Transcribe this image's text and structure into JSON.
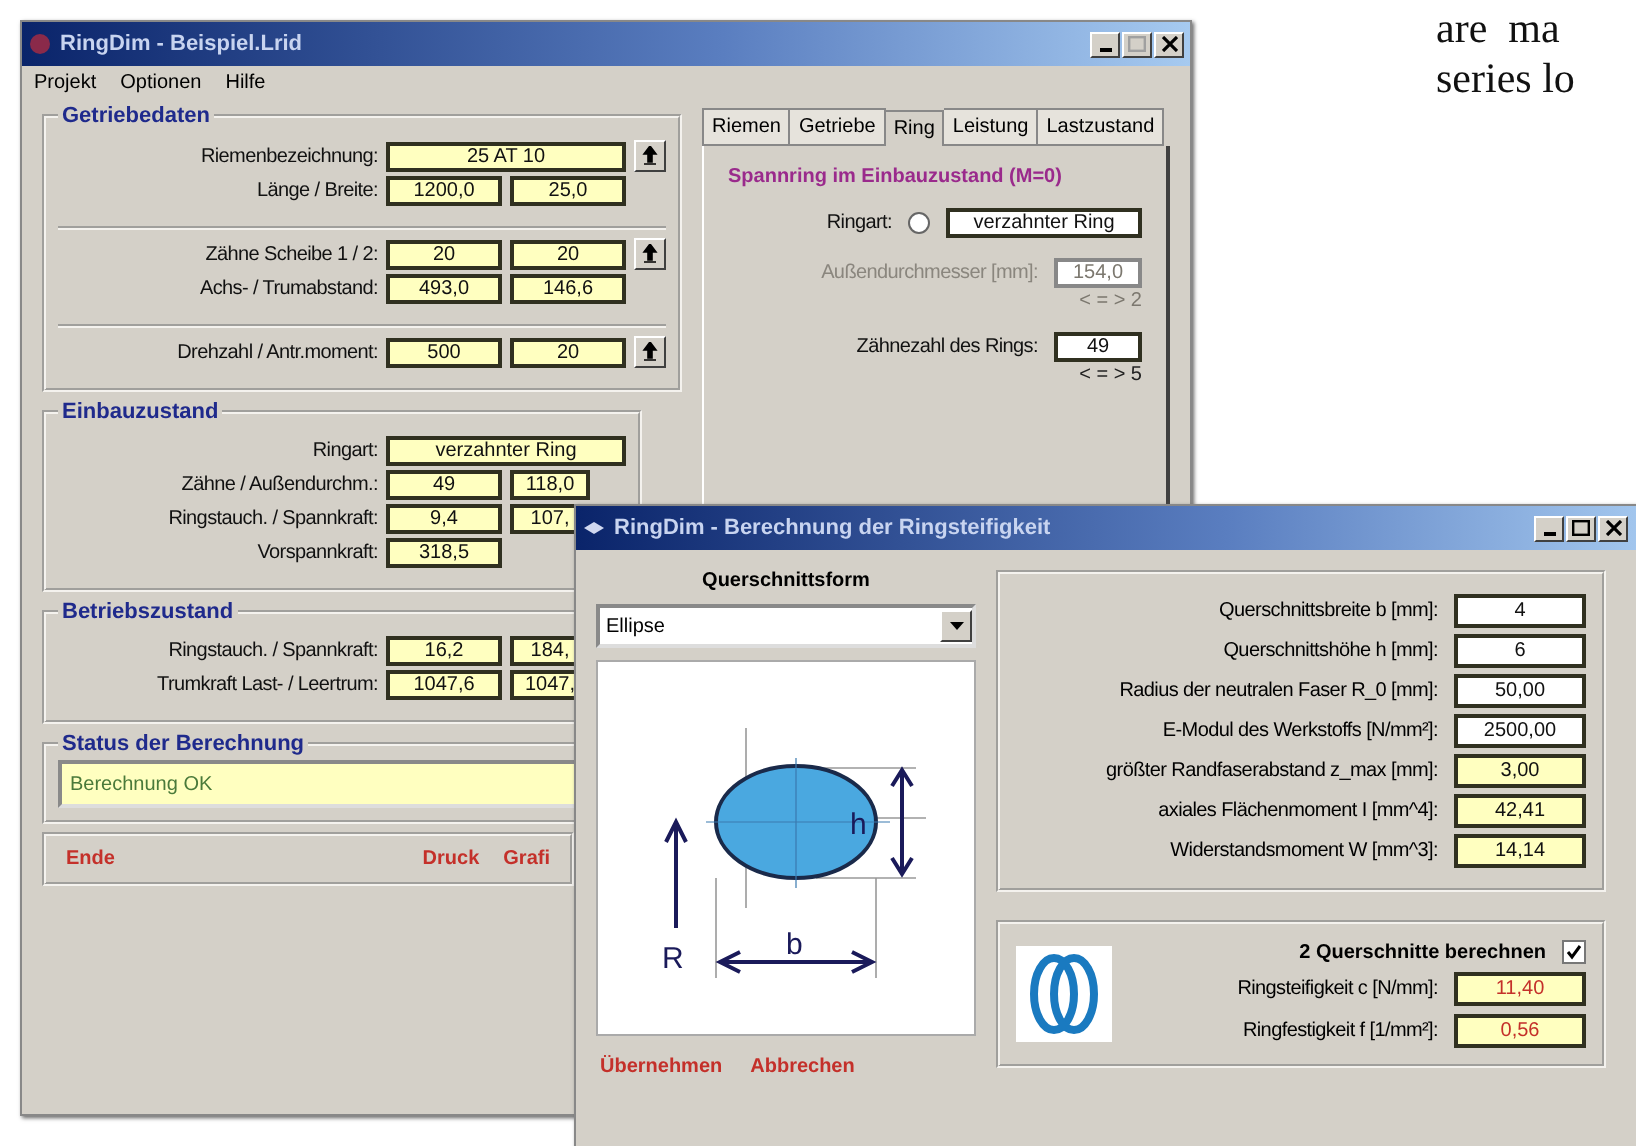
{
  "background_text": [
    "are  ma",
    "series lo"
  ],
  "main_window": {
    "title": "RingDim - Beispiel.Lrid",
    "controls": [
      {
        "kind": "minimize",
        "disabled": false
      },
      {
        "kind": "maximize",
        "disabled": true
      },
      {
        "kind": "close",
        "disabled": false
      }
    ],
    "menu": [
      "Projekt",
      "Optionen",
      "Hilfe"
    ],
    "groups": [
      {
        "title": "Getriebedaten",
        "sections": [
          {
            "rows": [
              {
                "label": "Riemenbezeichnung:",
                "values": [
                  "25 AT 10"
                ],
                "wide": true,
                "action": true
              },
              {
                "label": "Länge / Breite:",
                "values": [
                  "1200,0",
                  "25,0"
                ],
                "wide": false,
                "action": false
              }
            ]
          },
          {
            "rows": [
              {
                "label": "Zähne Scheibe 1 / 2:",
                "values": [
                  "20",
                  "20"
                ],
                "wide": false,
                "action": true
              },
              {
                "label": "Achs- / Trumabstand:",
                "values": [
                  "493,0",
                  "146,6"
                ],
                "wide": false,
                "action": false
              }
            ]
          },
          {
            "rows": [
              {
                "label": "Drehzahl / Antr.moment:",
                "values": [
                  "500",
                  "20"
                ],
                "wide": false,
                "action": true
              }
            ]
          }
        ]
      },
      {
        "title": "Einbauzustand",
        "sections": [
          {
            "rows": [
              {
                "label": "Ringart:",
                "values": [
                  "verzahnter Ring"
                ],
                "wide": true,
                "action": false
              },
              {
                "label": "Zähne / Außendurchm.:",
                "values": [
                  "49",
                  "118,0"
                ],
                "wide": false,
                "action": false
              },
              {
                "label": "Ringstauch. / Spannkraft:",
                "values": [
                  "9,4",
                  "107,"
                ],
                "wide": false,
                "action": false
              },
              {
                "label": "Vorspannkraft:",
                "values": [
                  "318,5"
                ],
                "wide": false,
                "action": false
              }
            ]
          }
        ]
      },
      {
        "title": "Betriebszustand",
        "sections": [
          {
            "rows": [
              {
                "label": "Ringstauch. / Spannkraft:",
                "values": [
                  "16,2",
                  "184,"
                ],
                "wide": false,
                "action": false
              },
              {
                "label": "Trumkraft Last- / Leertrum:",
                "values": [
                  "1047,6",
                  "1047,"
                ],
                "wide": false,
                "action": false
              }
            ]
          }
        ]
      }
    ],
    "status": {
      "title": "Status der Berechnung",
      "message": "Berechnung OK"
    },
    "buttons": [
      "Ende",
      "Druck",
      "Grafi"
    ]
  },
  "tab_panel": {
    "tabs": [
      {
        "label": "Riemen",
        "selected": false
      },
      {
        "label": "Getriebe",
        "selected": false
      },
      {
        "label": "Ring",
        "selected": true
      },
      {
        "label": "Leistung",
        "selected": false
      },
      {
        "label": "Lastzustand",
        "selected": false
      }
    ],
    "heading": "Spannring im Einbauzustand (M=0)",
    "ringart": {
      "label": "Ringart:",
      "selected": false,
      "value": "verzahnter Ring"
    },
    "rows": [
      {
        "label": "Außendurchmesser [mm]:",
        "value": "154,0",
        "stepper": "< = > 2",
        "disabled": true
      },
      {
        "label": "Zähnezahl des Rings:",
        "value": "49",
        "stepper": "< = > 5",
        "disabled": false
      }
    ]
  },
  "dialog": {
    "title": "RingDim - Berechnung der Ringsteifigkeit",
    "controls": [
      {
        "kind": "minimize",
        "disabled": false
      },
      {
        "kind": "maximize",
        "disabled": false
      },
      {
        "kind": "close",
        "disabled": false
      }
    ],
    "shape_label": "Querschnittsform",
    "shape": "Ellipse",
    "dimension_labels": [
      "h",
      "R",
      "b"
    ],
    "buttons": [
      "Übernehmen",
      "Abbrechen"
    ],
    "properties": [
      {
        "label": "Querschnittsbreite b [mm]:",
        "value": "4",
        "kind": "input"
      },
      {
        "label": "Querschnittshöhe h [mm]:",
        "value": "6",
        "kind": "input"
      },
      {
        "label": "Radius der neutralen Faser R_0 [mm]:",
        "value": "50,00",
        "kind": "input"
      },
      {
        "label": "E-Modul des Werkstoffs [N/mm²]:",
        "value": "2500,00",
        "kind": "input"
      },
      {
        "label": "größter Randfaserabstand z_max [mm]:",
        "value": "3,00",
        "kind": "output"
      },
      {
        "label": "axiales Flächenmoment I [mm^4]:",
        "value": "42,41",
        "kind": "output"
      },
      {
        "label": "Widerstandsmoment W [mm^3]:",
        "value": "14,14",
        "kind": "output"
      }
    ],
    "two_sections": {
      "label": "2 Querschnitte berechnen",
      "checked": true
    },
    "results": [
      {
        "label": "Ringsteifigkeit c [N/mm]:",
        "value": "11,40",
        "kind": "result"
      },
      {
        "label": "Ringfestigkeit f [1/mm²]:",
        "value": "0,56",
        "kind": "result"
      }
    ]
  }
}
